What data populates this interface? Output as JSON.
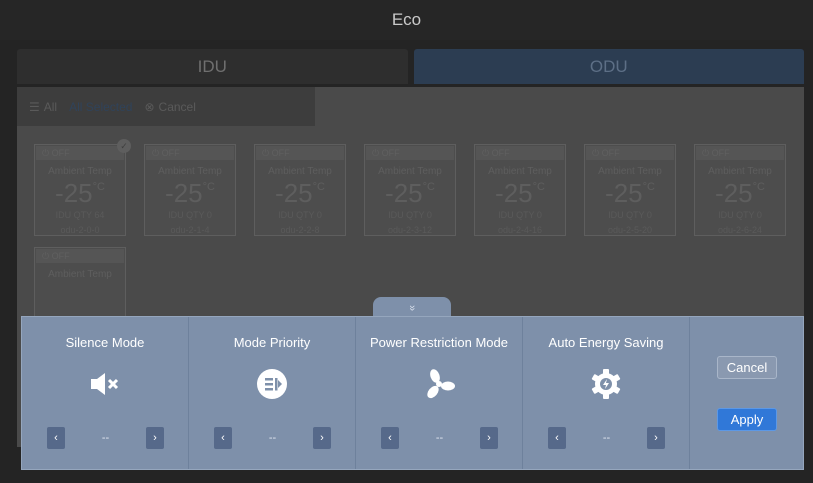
{
  "title": "Eco",
  "tabs": [
    {
      "label": "IDU",
      "active": false
    },
    {
      "label": "ODU",
      "active": true
    }
  ],
  "toolbar": {
    "all_label": "All",
    "selection_label": "All Selected",
    "cancel_label": "Cancel"
  },
  "cards": [
    {
      "state": "OFF",
      "label": "Ambient Temp",
      "temp": "-25",
      "unit": "°C",
      "qty": "IDU QTY 64",
      "name": "odu-2-0-0",
      "checked": true
    },
    {
      "state": "OFF",
      "label": "Ambient Temp",
      "temp": "-25",
      "unit": "°C",
      "qty": "IDU QTY 0",
      "name": "odu-2-1-4",
      "checked": false
    },
    {
      "state": "OFF",
      "label": "Ambient Temp",
      "temp": "-25",
      "unit": "°C",
      "qty": "IDU QTY 0",
      "name": "odu-2-2-8",
      "checked": false
    },
    {
      "state": "OFF",
      "label": "Ambient Temp",
      "temp": "-25",
      "unit": "°C",
      "qty": "IDU QTY 0",
      "name": "odu-2-3-12",
      "checked": false
    },
    {
      "state": "OFF",
      "label": "Ambient Temp",
      "temp": "-25",
      "unit": "°C",
      "qty": "IDU QTY 0",
      "name": "odu-2-4-16",
      "checked": false
    },
    {
      "state": "OFF",
      "label": "Ambient Temp",
      "temp": "-25",
      "unit": "°C",
      "qty": "IDU QTY 0",
      "name": "odu-2-5-20",
      "checked": false
    },
    {
      "state": "OFF",
      "label": "Ambient Temp",
      "temp": "-25",
      "unit": "°C",
      "qty": "IDU QTY 0",
      "name": "odu-2-6-24",
      "checked": false
    },
    {
      "state": "OFF",
      "label": "Ambient Temp",
      "temp": "",
      "unit": "",
      "qty": "",
      "name": "",
      "checked": false
    }
  ],
  "panel": {
    "sections": [
      {
        "title": "Silence Mode",
        "icon": "speaker-mute-icon",
        "value": "--",
        "prev": "‹",
        "next": "›"
      },
      {
        "title": "Mode Priority",
        "icon": "mode-priority-icon",
        "value": "--",
        "prev": "‹",
        "next": "›"
      },
      {
        "title": "Power Restriction Mode",
        "icon": "fan-icon",
        "value": "--",
        "prev": "‹",
        "next": "›"
      },
      {
        "title": "Auto Energy Saving",
        "icon": "energy-gear-icon",
        "value": "--",
        "prev": "‹",
        "next": "›"
      }
    ],
    "cancel_label": "Cancel",
    "apply_label": "Apply",
    "expand_glyph": "»"
  },
  "colors": {
    "panel": "#7e90aa",
    "apply": "#3078d8"
  }
}
